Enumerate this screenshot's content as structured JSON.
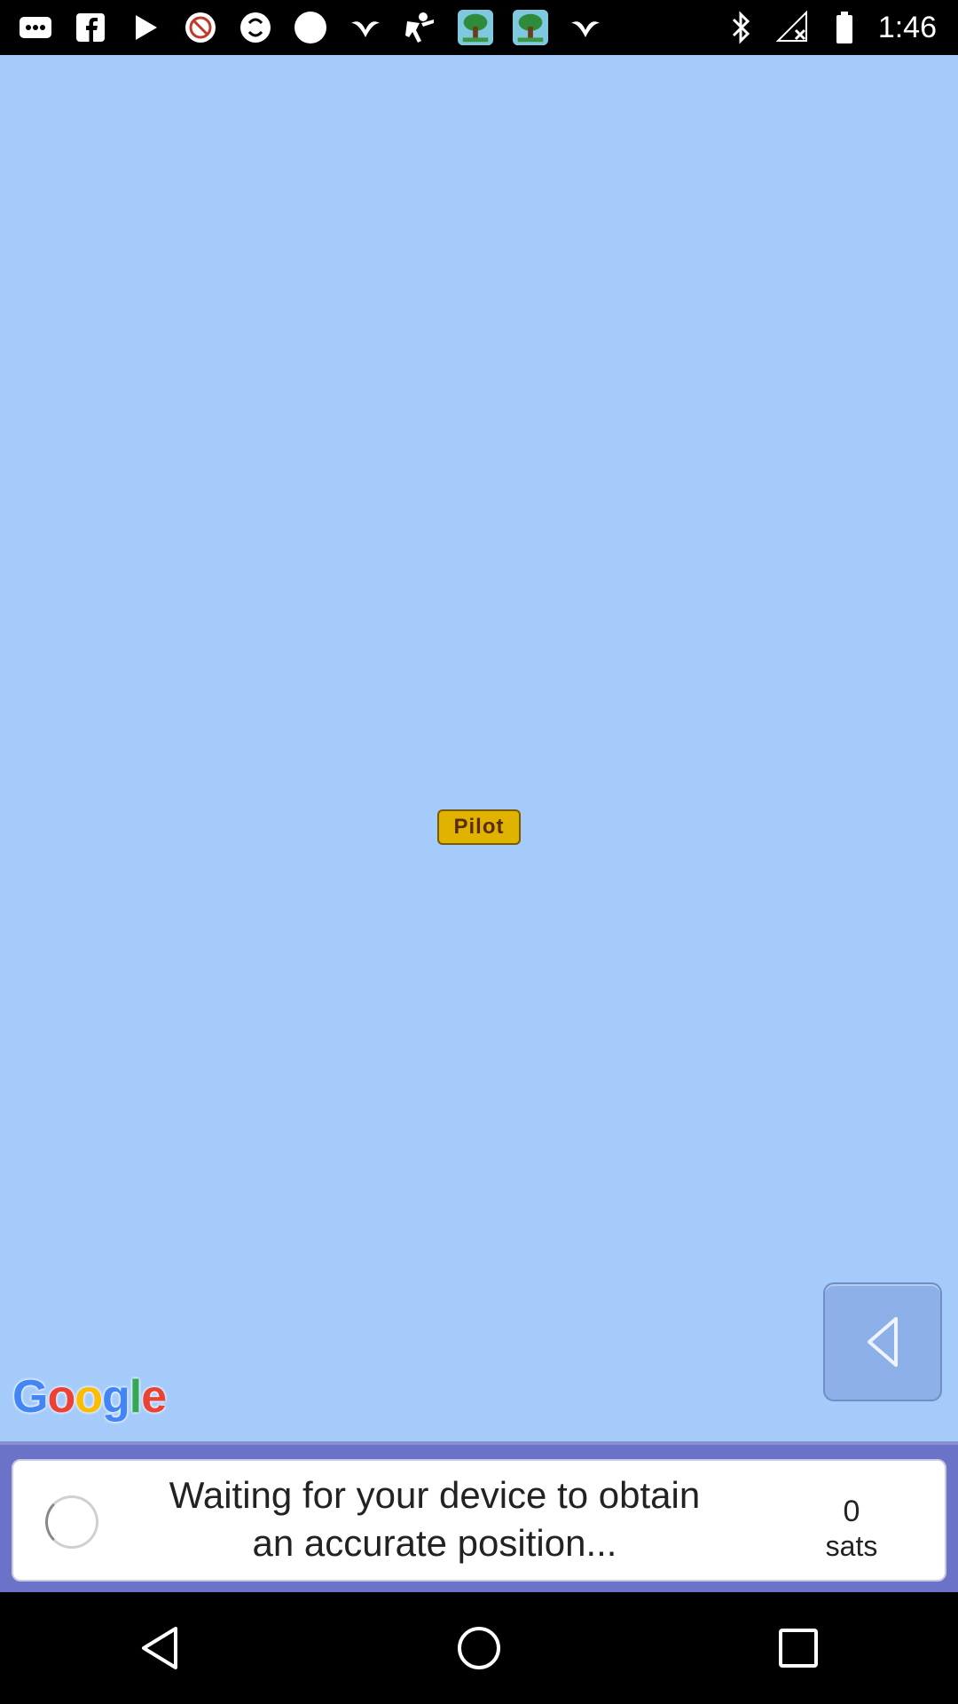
{
  "status_bar": {
    "time": "1:46",
    "icons": [
      "more-icon",
      "facebook-icon",
      "play-icon",
      "blocked-icon",
      "sync-icon",
      "circle-icon",
      "bird-icon",
      "person-icon",
      "tree-app-icon",
      "tree-app-icon",
      "bird-icon",
      "bluetooth-icon"
    ]
  },
  "map": {
    "attribution": "Google",
    "marker_label": "Pilot",
    "background_color": "#a5cbfb"
  },
  "status_panel": {
    "message": "Waiting for your device to obtain an accurate position...",
    "sats_count": "0",
    "sats_label": "sats"
  },
  "nav_bar": {
    "buttons": [
      "back-icon",
      "home-icon",
      "recents-icon"
    ]
  }
}
